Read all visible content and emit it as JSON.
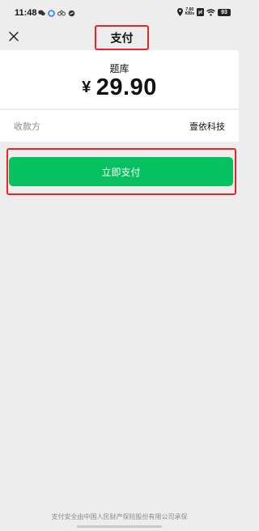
{
  "status_bar": {
    "time": "11:48",
    "net_speed_value": "7.60",
    "net_speed_unit": "KB/s",
    "battery": "93"
  },
  "nav": {
    "title": "支付",
    "close_icon": "close-icon"
  },
  "payment": {
    "product": "题库",
    "currency_symbol": "¥",
    "amount": "29.90"
  },
  "payee": {
    "label": "收款方",
    "name": "壹依科技"
  },
  "actions": {
    "pay_label": "立即支付"
  },
  "footer": {
    "note": "支付安全由中国人民财产保险股份有限公司承保"
  },
  "colors": {
    "accent_green": "#07c160",
    "highlight_red": "#e8262a",
    "background": "#ededed"
  }
}
